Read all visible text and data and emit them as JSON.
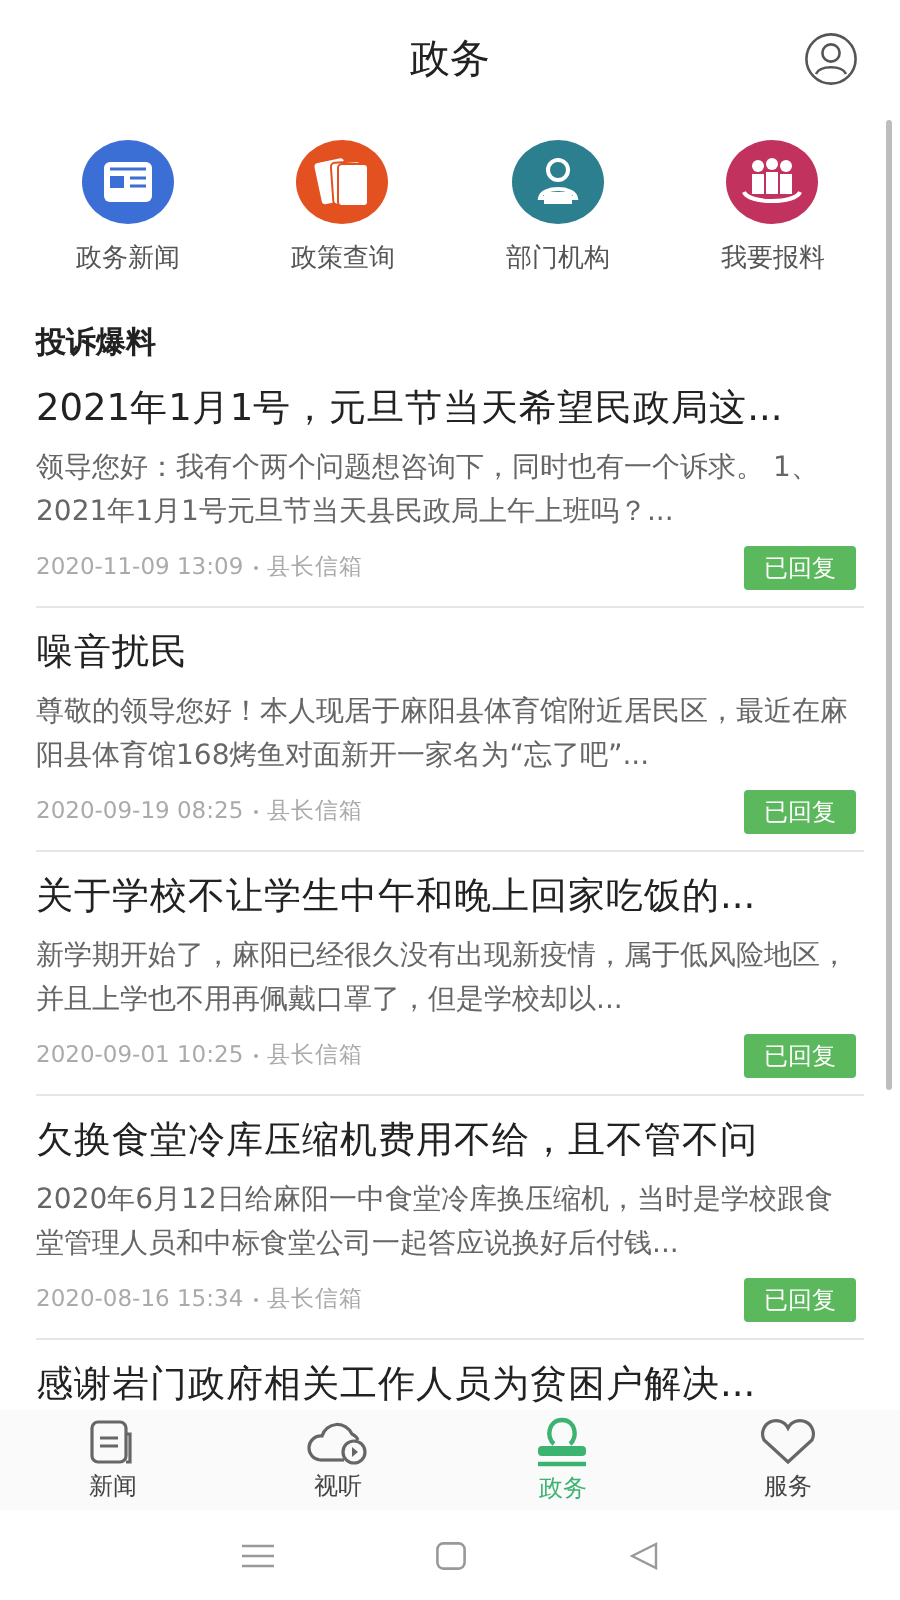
{
  "header": {
    "title": "政务"
  },
  "shortcuts": [
    {
      "label": "政务新闻",
      "kind": "news",
      "color": "#3b6fd6"
    },
    {
      "label": "政策查询",
      "kind": "policy",
      "color": "#e2511f"
    },
    {
      "label": "部门机构",
      "kind": "department",
      "color": "#2b7f8e"
    },
    {
      "label": "我要报料",
      "kind": "report",
      "color": "#c2325e"
    }
  ],
  "section": {
    "title": "投诉爆料"
  },
  "posts": [
    {
      "title": "2021年1月1号，元旦节当天希望民政局这...",
      "summary": "领导您好：我有个两个问题想咨询下，同时也有一个诉求。 1、2021年1月1号元旦节当天县民政局上午上班吗？...",
      "time": "2020-11-09 13:09",
      "source": "县长信箱",
      "status": "已回复"
    },
    {
      "title": "噪音扰民",
      "summary": "尊敬的领导您好！本人现居于麻阳县体育馆附近居民区，最近在麻阳县体育馆168烤鱼对面新开一家名为“忘了吧”...",
      "time": "2020-09-19 08:25",
      "source": "县长信箱",
      "status": "已回复"
    },
    {
      "title": "关于学校不让学生中午和晚上回家吃饭的...",
      "summary": "新学期开始了，麻阳已经很久没有出现新疫情，属于低风险地区，并且上学也不用再佩戴口罩了，但是学校却以...",
      "time": "2020-09-01 10:25",
      "source": "县长信箱",
      "status": "已回复"
    },
    {
      "title": "欠换食堂冷库压缩机费用不给，且不管不问",
      "summary": "2020年6月12日给麻阳一中食堂冷库换压缩机，当时是学校跟食堂管理人员和中标食堂公司一起答应说换好后付钱...",
      "time": "2020-08-16 15:34",
      "source": "县长信箱",
      "status": "已回复"
    },
    {
      "title": "感谢岩门政府相关工作人员为贫困户解决..."
    }
  ],
  "tabs": [
    {
      "label": "新闻",
      "kind": "news",
      "selected": false
    },
    {
      "label": "视听",
      "kind": "video",
      "selected": false
    },
    {
      "label": "政务",
      "kind": "gov",
      "selected": true
    },
    {
      "label": "服务",
      "kind": "service",
      "selected": false
    }
  ]
}
